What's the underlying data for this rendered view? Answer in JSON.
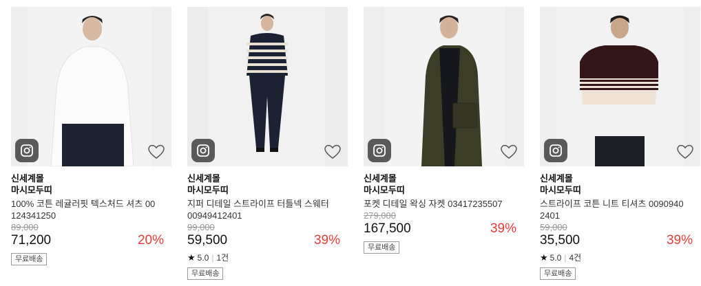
{
  "products": [
    {
      "store": "신세계몰",
      "brand": "마시모두띠",
      "name": "100% 코튼 레귤러핏 텍스처드 셔츠 00124341250",
      "original_price": "89,000",
      "price": "71,200",
      "discount": "20%",
      "rating": null,
      "review_count": null,
      "badge": "무료배송"
    },
    {
      "store": "신세계몰",
      "brand": "마시모두띠",
      "name": "지퍼 디테일 스트라이프 터틀넥 스웨터 00949412401",
      "original_price": "99,000",
      "price": "59,500",
      "discount": "39%",
      "rating": "5.0",
      "review_count": "1건",
      "badge": "무료배송"
    },
    {
      "store": "신세계몰",
      "brand": "마시모두띠",
      "name": "포켓 디테일 왁싱 자켓 03417235507",
      "original_price": "279,000",
      "price": "167,500",
      "discount": "39%",
      "rating": null,
      "review_count": null,
      "badge": "무료배송"
    },
    {
      "store": "신세계몰",
      "brand": "마시모두띠",
      "name": "스트라이프 코튼 니트 티셔츠 00909402401",
      "original_price": "59,000",
      "price": "35,500",
      "discount": "39%",
      "rating": "5.0",
      "review_count": "4건",
      "badge": "무료배송"
    }
  ],
  "icons": {
    "social": "instagram-icon",
    "wishlist": "heart-outline-icon",
    "rating": "star-icon"
  },
  "colors": {
    "discount": "#e83a3a",
    "instagram_bg": "#5a5a5a"
  }
}
